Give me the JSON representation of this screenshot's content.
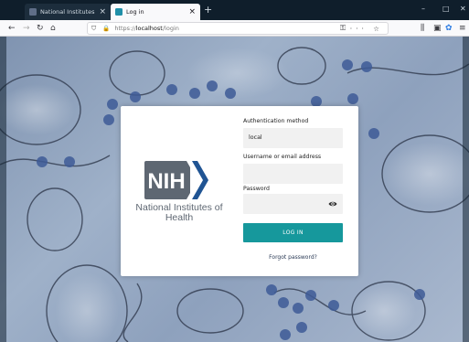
{
  "browser": {
    "tabs": [
      {
        "label": "National Institutes of Health (NI",
        "icon": "nih-favicon",
        "active": false
      },
      {
        "label": "Log in",
        "icon": "login-favicon",
        "active": true
      }
    ],
    "url": {
      "scheme": "https://",
      "host": "localhost",
      "path": "/login"
    }
  },
  "login": {
    "logo": {
      "mark": "NIH",
      "name": "National Institutes of Health"
    },
    "auth_method_label": "Authentication method",
    "auth_method_value": "local",
    "username_label": "Username or email address",
    "username_value": "",
    "password_label": "Password",
    "password_value": "",
    "login_button": "LOG IN",
    "forgot_link": "Forgot password?"
  },
  "colors": {
    "accent": "#16989c",
    "nih_gray": "#5e6772",
    "nih_blue": "#205493",
    "browser_dark": "#0f1e2b"
  }
}
